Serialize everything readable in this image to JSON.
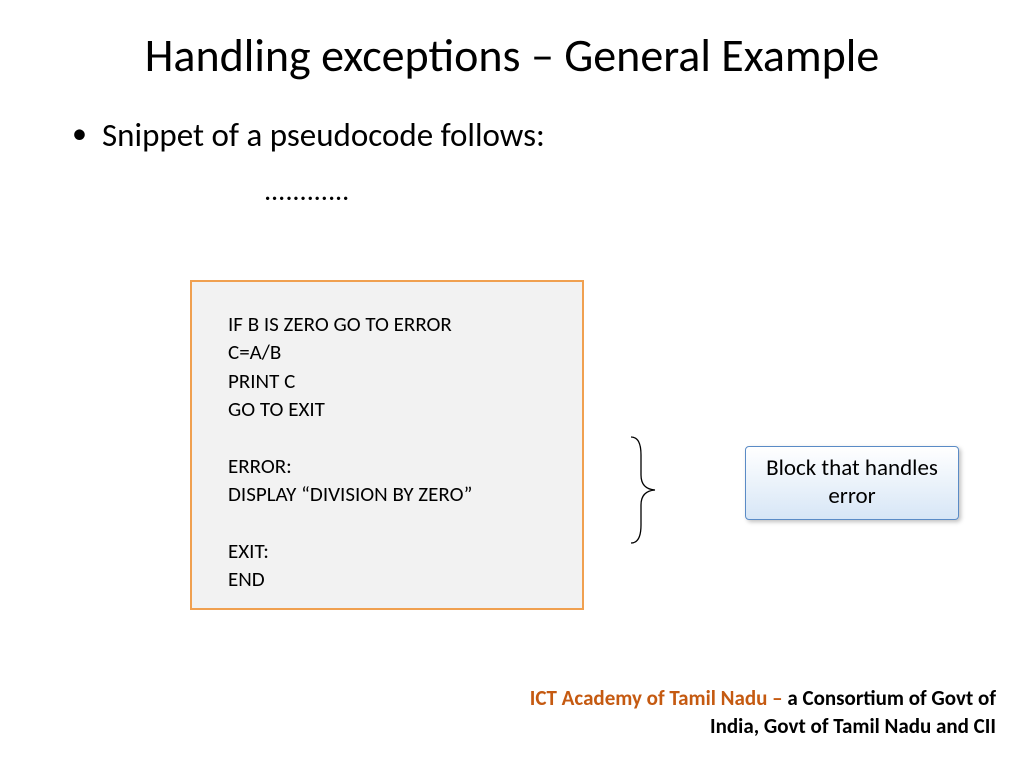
{
  "title": "Handling exceptions – General Example",
  "bullet": "Snippet of a pseudocode follows:",
  "ellipsis": "…………",
  "code": {
    "l1": "IF B IS ZERO GO TO ERROR",
    "l2": "C=A/B",
    "l3": "PRINT C",
    "l4": "GO TO EXIT",
    "l5": "",
    "l6": "ERROR:",
    "l7": "DISPLAY “DIVISION BY ZERO”",
    "l8": "",
    "l9": "EXIT:",
    "l10": "END"
  },
  "callout": "Block that handles error",
  "footer": {
    "org": "ICT Academy of Tamil Nadu",
    "dash": " – ",
    "desc_part1": "a Consortium of Govt of",
    "desc_part2": "India, Govt of Tamil Nadu and CII"
  }
}
